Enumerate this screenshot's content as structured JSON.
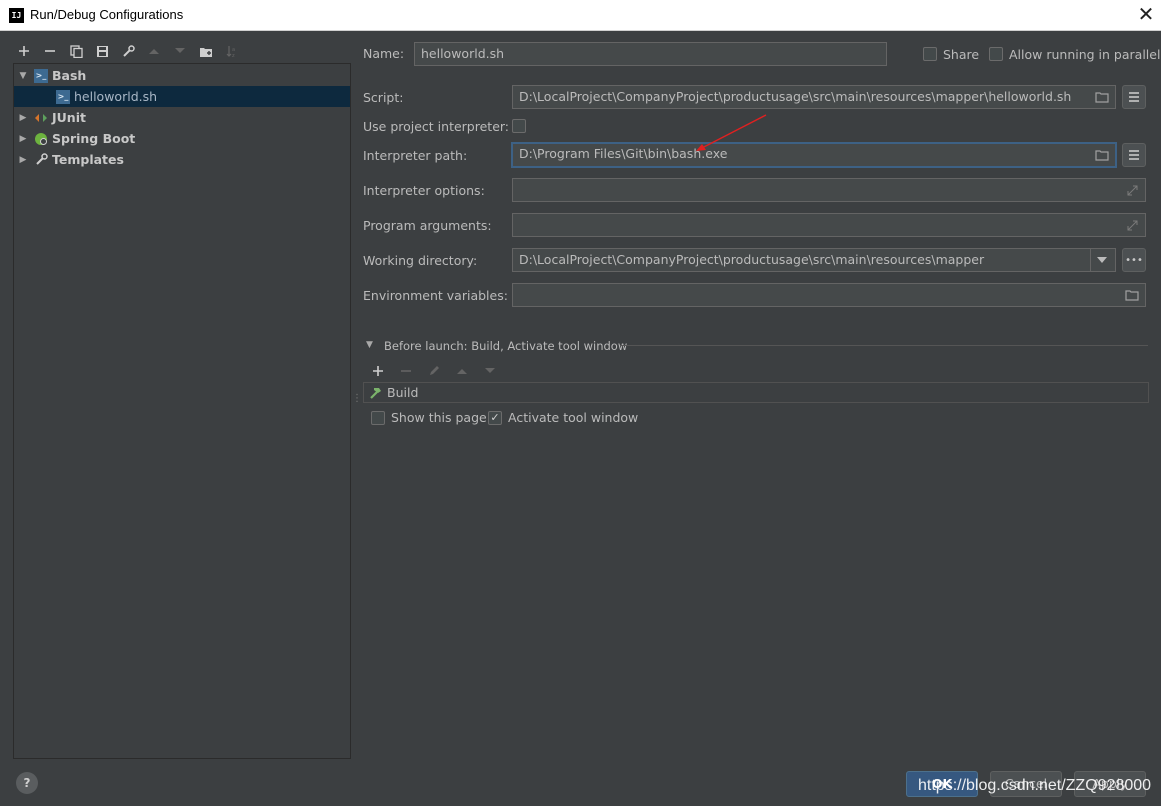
{
  "window": {
    "title": "Run/Debug Configurations",
    "app_icon": "IJ",
    "close_symbol": "✕"
  },
  "toolbar": [
    "add-icon",
    "remove-icon",
    "copy-icon",
    "save-icon",
    "wrench-icon",
    "move-up-icon",
    "move-down-icon",
    "folder-add-icon",
    "sort-icon"
  ],
  "tree": {
    "items": [
      {
        "label": "Bash",
        "expanded": true
      },
      {
        "label": "helloworld.sh",
        "selected": true
      },
      {
        "label": "JUnit"
      },
      {
        "label": "Spring Boot"
      },
      {
        "label": "Templates"
      }
    ]
  },
  "form": {
    "name_label": "Name:",
    "name_value": "helloworld.sh",
    "share_label": "Share",
    "parallel_label": "Allow running in parallel",
    "script_label": "Script:",
    "script_value": "D:\\LocalProject\\CompanyProject\\productusage\\src\\main\\resources\\mapper\\helloworld.sh",
    "use_project_interpreter_label": "Use project interpreter:",
    "interpreter_path_label": "Interpreter path:",
    "interpreter_path_value": "D:\\Program Files\\Git\\bin\\bash.exe",
    "interpreter_options_label": "Interpreter options:",
    "interpreter_options_value": "",
    "program_arguments_label": "Program arguments:",
    "program_arguments_value": "",
    "working_directory_label": "Working directory:",
    "working_directory_value": "D:\\LocalProject\\CompanyProject\\productusage\\src\\main\\resources\\mapper",
    "environment_variables_label": "Environment variables:",
    "environment_variables_value": ""
  },
  "before_launch": {
    "header": "Before launch: Build, Activate tool window",
    "tasks": [
      "Build"
    ],
    "show_this_page_label": "Show this page",
    "show_this_page_checked": false,
    "activate_tool_window_label": "Activate tool window",
    "activate_tool_window_checked": true
  },
  "footer": {
    "help_label": "?",
    "ok_label": "OK",
    "cancel_label": "Cancel",
    "apply_label": "Apply",
    "watermark": "https://blog.csdn.net/ZZQ928000"
  },
  "colors": {
    "background": "#3c3f41",
    "field_bg": "#45494a",
    "selection": "#0d293e",
    "ok_button": "#365880",
    "annotation_arrow": "#e02020"
  }
}
